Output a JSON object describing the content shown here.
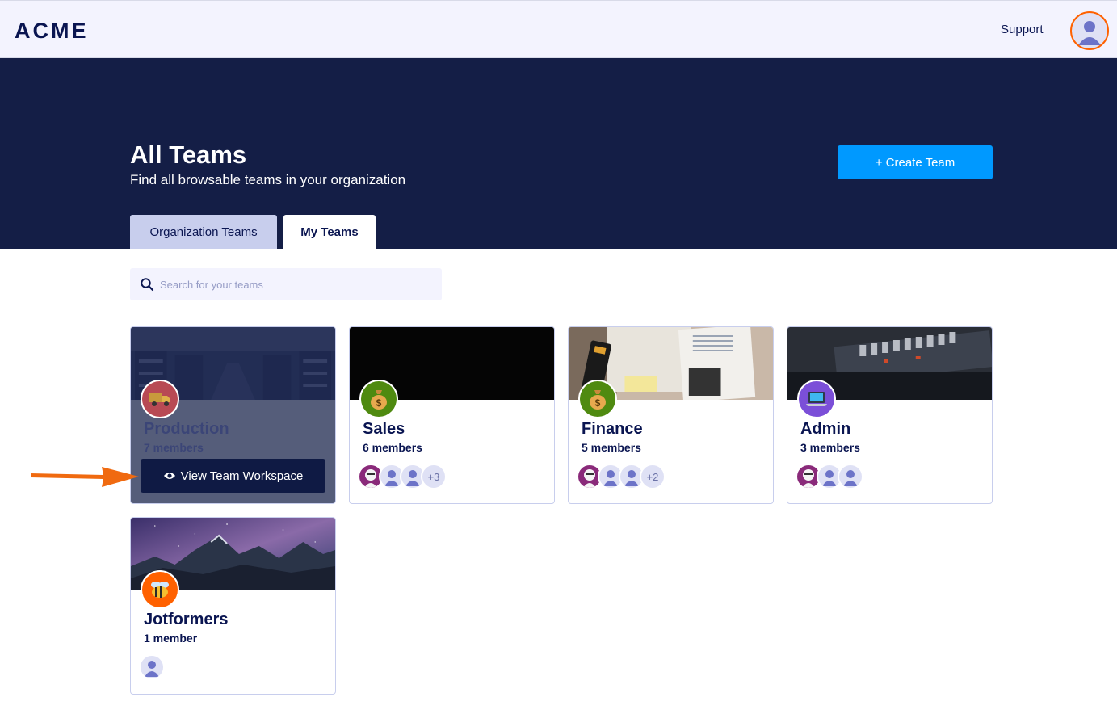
{
  "header": {
    "logo": "ACME",
    "support_label": "Support"
  },
  "hero": {
    "title": "All Teams",
    "subtitle": "Find all browsable teams in your organization",
    "create_label": "+ Create Team",
    "tabs": [
      {
        "label": "Organization Teams"
      },
      {
        "label": "My Teams"
      }
    ],
    "active_tab": "My Teams"
  },
  "search": {
    "placeholder": "Search for your teams",
    "value": ""
  },
  "teams": [
    {
      "name": "Production",
      "count": "7 members",
      "icon": "delivery-truck-icon",
      "hover_action": "View Team Workspace"
    },
    {
      "name": "Sales",
      "count": "6 members",
      "icon": "money-bag-icon",
      "more": "+3"
    },
    {
      "name": "Finance",
      "count": "5 members",
      "icon": "money-bag-icon",
      "more": "+2"
    },
    {
      "name": "Admin",
      "count": "3 members",
      "icon": "laptop-icon"
    },
    {
      "name": "Jotformers",
      "count": "1 member",
      "icon": "bee-icon"
    }
  ],
  "colors": {
    "navy": "#0a1551",
    "hero": "#141e46",
    "accent": "#0099ff",
    "orange": "#ff6100"
  }
}
